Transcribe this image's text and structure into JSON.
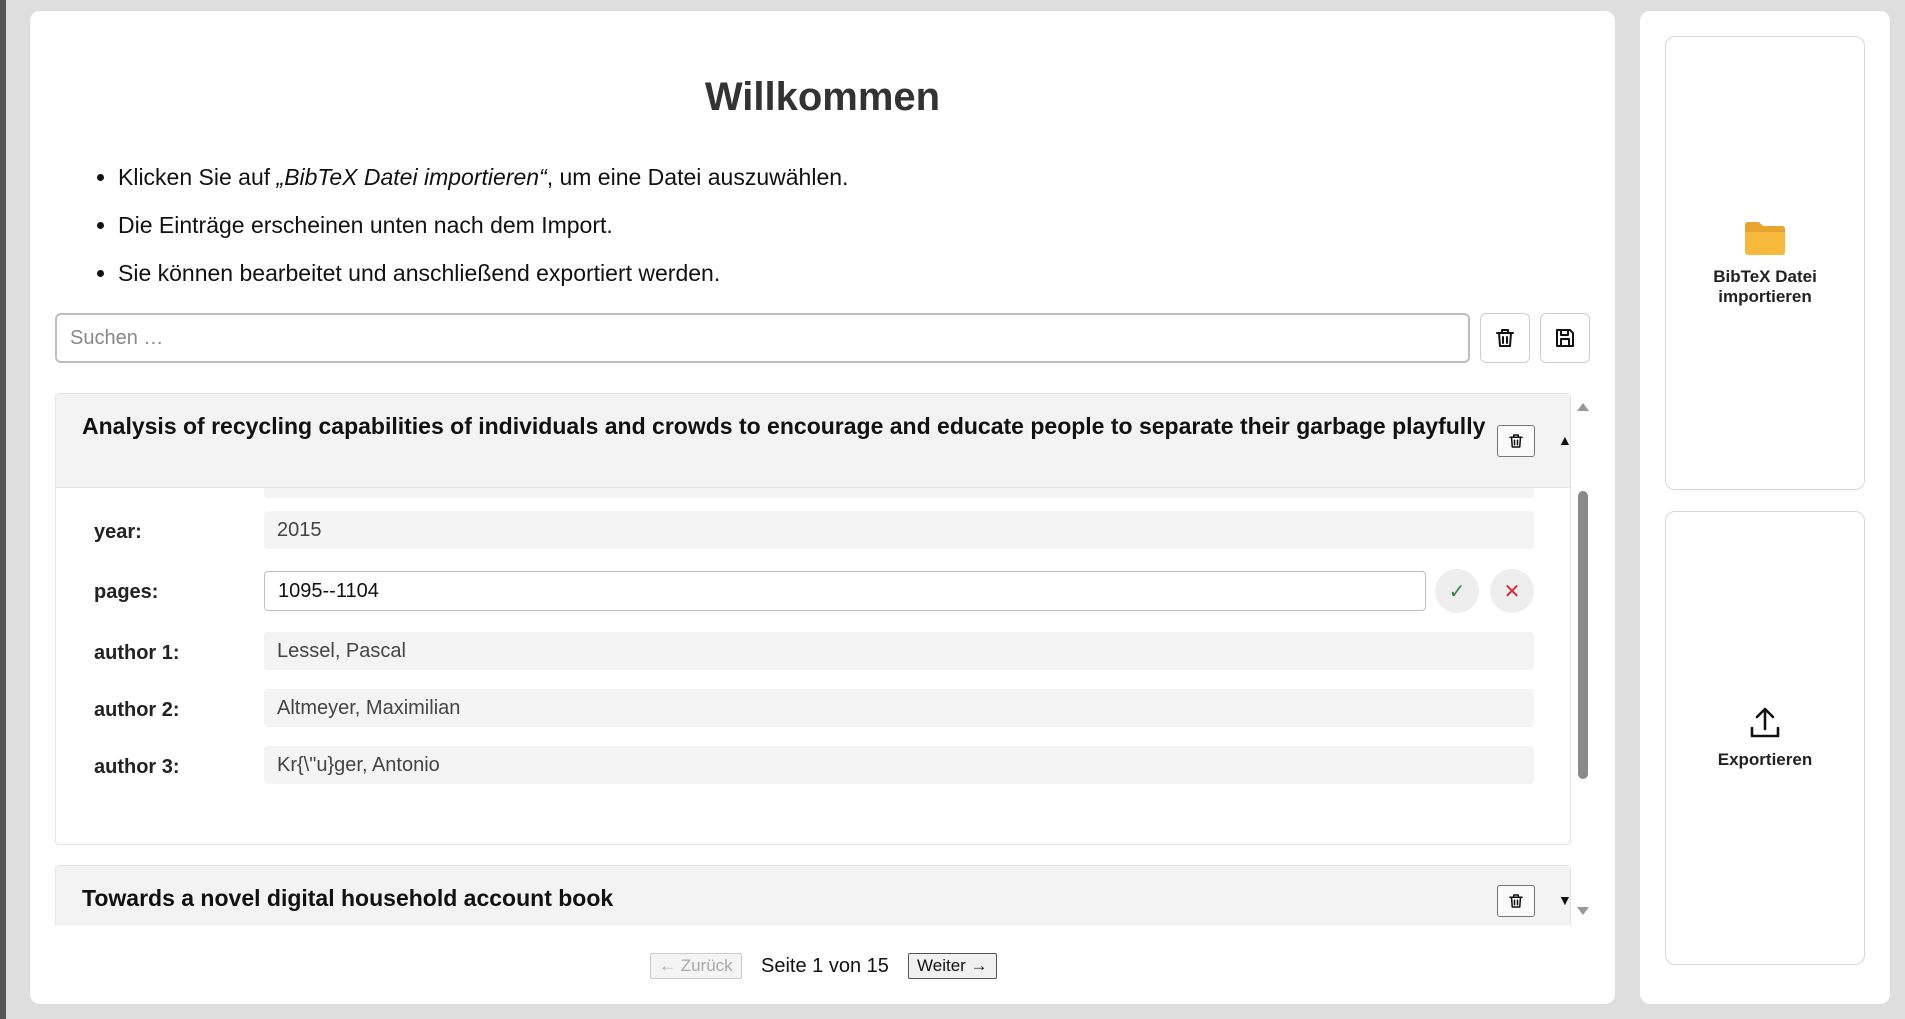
{
  "main": {
    "title": "Willkommen",
    "intro": {
      "line1_prefix": "Klicken Sie auf ",
      "line1_emph": "„BibTeX Datei importieren“",
      "line1_suffix": ", um eine Datei auszuwählen.",
      "line2": "Die Einträge erscheinen unten nach dem Import.",
      "line3": "Sie können bearbeitet und anschließend exportiert werden."
    },
    "search": {
      "placeholder": "Suchen …",
      "value": ""
    },
    "toolbar_icons": [
      "trash-icon",
      "save-icon"
    ]
  },
  "entries": [
    {
      "title": "Analysis of recycling capabilities of individuals and crowds to encourage and educate people to separate their garbage playfully",
      "expanded": true,
      "toggle_glyph": "▲",
      "fields": [
        {
          "label": "year:",
          "value": "2015"
        },
        {
          "label": "pages:",
          "value": "1095--1104",
          "editing": true
        },
        {
          "label": "author 1:",
          "value": "Lessel, Pascal"
        },
        {
          "label": "author 2:",
          "value": "Altmeyer, Maximilian"
        },
        {
          "label": "author 3:",
          "value": "Kr{\\\"u}ger, Antonio"
        }
      ]
    },
    {
      "title": "Towards a novel digital household account book",
      "expanded": false,
      "toggle_glyph": "▼"
    }
  ],
  "edit_actions": {
    "confirm": "✓",
    "cancel": "✕"
  },
  "pagination": {
    "prev_label": "← Zurück",
    "info": "Seite 1 von 15",
    "next_label": "Weiter →",
    "prev_disabled": true
  },
  "sidebar": {
    "import_label_line1": "BibTeX Datei",
    "import_label_line2": "importieren",
    "export_label": "Exportieren"
  },
  "colors": {
    "background": "#dedede",
    "confirm": "#2e8b3f",
    "cancel": "#d42a3a",
    "folder": "#f6b93b"
  }
}
